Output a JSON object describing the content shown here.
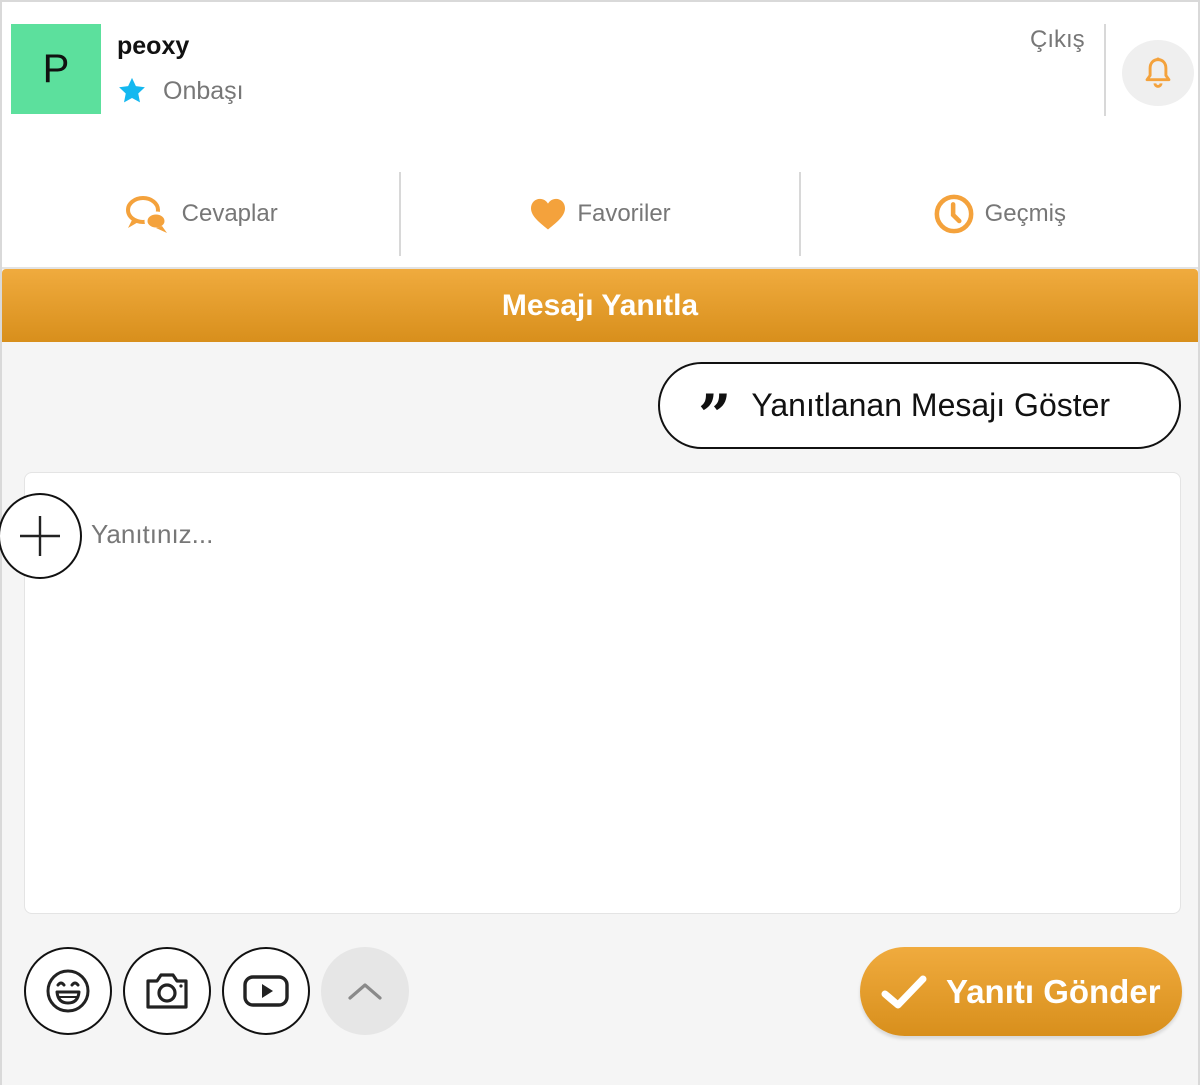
{
  "profile": {
    "avatar_letter": "P",
    "username": "peoxy",
    "rank": "Onbaşı",
    "logout": "Çıkış"
  },
  "tabs": [
    {
      "label": "Cevaplar",
      "icon": "chat-bubbles-icon"
    },
    {
      "label": "Favoriler",
      "icon": "heart-icon"
    },
    {
      "label": "Geçmiş",
      "icon": "clock-icon"
    }
  ],
  "reply": {
    "title": "Mesajı Yanıtla",
    "show_quote": "Yanıtlanan Mesajı Göster",
    "placeholder": "Yanıtınız...",
    "send": "Yanıtı Gönder",
    "tools": [
      "emoji-icon",
      "camera-icon",
      "youtube-icon",
      "chevron-up-icon"
    ]
  },
  "colors": {
    "accent": "#e89b2a",
    "avatar_bg": "#5ce09d",
    "star": "#14b8f0",
    "icon_orange": "#f4a23c"
  }
}
